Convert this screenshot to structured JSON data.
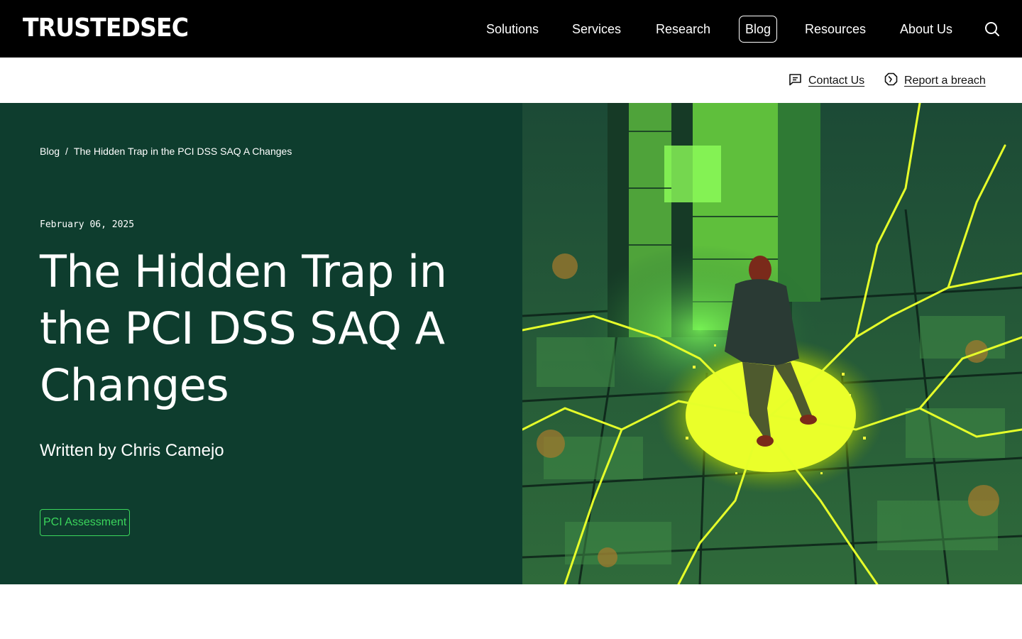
{
  "header": {
    "logo_text": "TRUSTEDSEC",
    "nav": [
      {
        "label": "Solutions"
      },
      {
        "label": "Services"
      },
      {
        "label": "Research"
      },
      {
        "label": "Blog"
      },
      {
        "label": "Resources"
      },
      {
        "label": "About Us"
      }
    ],
    "active_nav": "Blog",
    "search_icon": "search-icon"
  },
  "utility": {
    "contact_label": "Contact Us",
    "contact_icon": "chat-icon",
    "breach_label": "Report a breach",
    "breach_icon": "alert-octagon-icon"
  },
  "hero": {
    "breadcrumb": {
      "root": "Blog",
      "separator": "/",
      "current": "The Hidden Trap in the PCI DSS SAQ A Changes"
    },
    "date": "February 06, 2025",
    "title": "The Hidden Trap in the PCI DSS SAQ A Changes",
    "author": "Written by Chris Camejo",
    "tag": "PCI Assessment",
    "image_description_icon": "hero-illustration",
    "colors": {
      "panel_bg": "#0e3d2e",
      "tag_accent": "#3bd65c",
      "nav_bg": "#000000"
    }
  }
}
